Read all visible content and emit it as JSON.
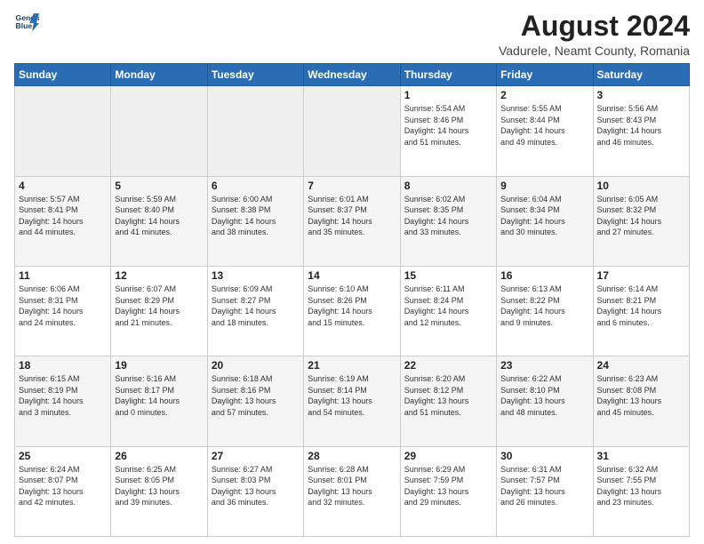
{
  "header": {
    "logo_line1": "General",
    "logo_line2": "Blue",
    "title": "August 2024",
    "subtitle": "Vadurele, Neamt County, Romania"
  },
  "weekdays": [
    "Sunday",
    "Monday",
    "Tuesday",
    "Wednesday",
    "Thursday",
    "Friday",
    "Saturday"
  ],
  "weeks": [
    [
      {
        "day": "",
        "info": ""
      },
      {
        "day": "",
        "info": ""
      },
      {
        "day": "",
        "info": ""
      },
      {
        "day": "",
        "info": ""
      },
      {
        "day": "1",
        "info": "Sunrise: 5:54 AM\nSunset: 8:46 PM\nDaylight: 14 hours\nand 51 minutes."
      },
      {
        "day": "2",
        "info": "Sunrise: 5:55 AM\nSunset: 8:44 PM\nDaylight: 14 hours\nand 49 minutes."
      },
      {
        "day": "3",
        "info": "Sunrise: 5:56 AM\nSunset: 8:43 PM\nDaylight: 14 hours\nand 46 minutes."
      }
    ],
    [
      {
        "day": "4",
        "info": "Sunrise: 5:57 AM\nSunset: 8:41 PM\nDaylight: 14 hours\nand 44 minutes."
      },
      {
        "day": "5",
        "info": "Sunrise: 5:59 AM\nSunset: 8:40 PM\nDaylight: 14 hours\nand 41 minutes."
      },
      {
        "day": "6",
        "info": "Sunrise: 6:00 AM\nSunset: 8:38 PM\nDaylight: 14 hours\nand 38 minutes."
      },
      {
        "day": "7",
        "info": "Sunrise: 6:01 AM\nSunset: 8:37 PM\nDaylight: 14 hours\nand 35 minutes."
      },
      {
        "day": "8",
        "info": "Sunrise: 6:02 AM\nSunset: 8:35 PM\nDaylight: 14 hours\nand 33 minutes."
      },
      {
        "day": "9",
        "info": "Sunrise: 6:04 AM\nSunset: 8:34 PM\nDaylight: 14 hours\nand 30 minutes."
      },
      {
        "day": "10",
        "info": "Sunrise: 6:05 AM\nSunset: 8:32 PM\nDaylight: 14 hours\nand 27 minutes."
      }
    ],
    [
      {
        "day": "11",
        "info": "Sunrise: 6:06 AM\nSunset: 8:31 PM\nDaylight: 14 hours\nand 24 minutes."
      },
      {
        "day": "12",
        "info": "Sunrise: 6:07 AM\nSunset: 8:29 PM\nDaylight: 14 hours\nand 21 minutes."
      },
      {
        "day": "13",
        "info": "Sunrise: 6:09 AM\nSunset: 8:27 PM\nDaylight: 14 hours\nand 18 minutes."
      },
      {
        "day": "14",
        "info": "Sunrise: 6:10 AM\nSunset: 8:26 PM\nDaylight: 14 hours\nand 15 minutes."
      },
      {
        "day": "15",
        "info": "Sunrise: 6:11 AM\nSunset: 8:24 PM\nDaylight: 14 hours\nand 12 minutes."
      },
      {
        "day": "16",
        "info": "Sunrise: 6:13 AM\nSunset: 8:22 PM\nDaylight: 14 hours\nand 9 minutes."
      },
      {
        "day": "17",
        "info": "Sunrise: 6:14 AM\nSunset: 8:21 PM\nDaylight: 14 hours\nand 6 minutes."
      }
    ],
    [
      {
        "day": "18",
        "info": "Sunrise: 6:15 AM\nSunset: 8:19 PM\nDaylight: 14 hours\nand 3 minutes."
      },
      {
        "day": "19",
        "info": "Sunrise: 6:16 AM\nSunset: 8:17 PM\nDaylight: 14 hours\nand 0 minutes."
      },
      {
        "day": "20",
        "info": "Sunrise: 6:18 AM\nSunset: 8:16 PM\nDaylight: 13 hours\nand 57 minutes."
      },
      {
        "day": "21",
        "info": "Sunrise: 6:19 AM\nSunset: 8:14 PM\nDaylight: 13 hours\nand 54 minutes."
      },
      {
        "day": "22",
        "info": "Sunrise: 6:20 AM\nSunset: 8:12 PM\nDaylight: 13 hours\nand 51 minutes."
      },
      {
        "day": "23",
        "info": "Sunrise: 6:22 AM\nSunset: 8:10 PM\nDaylight: 13 hours\nand 48 minutes."
      },
      {
        "day": "24",
        "info": "Sunrise: 6:23 AM\nSunset: 8:08 PM\nDaylight: 13 hours\nand 45 minutes."
      }
    ],
    [
      {
        "day": "25",
        "info": "Sunrise: 6:24 AM\nSunset: 8:07 PM\nDaylight: 13 hours\nand 42 minutes."
      },
      {
        "day": "26",
        "info": "Sunrise: 6:25 AM\nSunset: 8:05 PM\nDaylight: 13 hours\nand 39 minutes."
      },
      {
        "day": "27",
        "info": "Sunrise: 6:27 AM\nSunset: 8:03 PM\nDaylight: 13 hours\nand 36 minutes."
      },
      {
        "day": "28",
        "info": "Sunrise: 6:28 AM\nSunset: 8:01 PM\nDaylight: 13 hours\nand 32 minutes."
      },
      {
        "day": "29",
        "info": "Sunrise: 6:29 AM\nSunset: 7:59 PM\nDaylight: 13 hours\nand 29 minutes."
      },
      {
        "day": "30",
        "info": "Sunrise: 6:31 AM\nSunset: 7:57 PM\nDaylight: 13 hours\nand 26 minutes."
      },
      {
        "day": "31",
        "info": "Sunrise: 6:32 AM\nSunset: 7:55 PM\nDaylight: 13 hours\nand 23 minutes."
      }
    ]
  ]
}
